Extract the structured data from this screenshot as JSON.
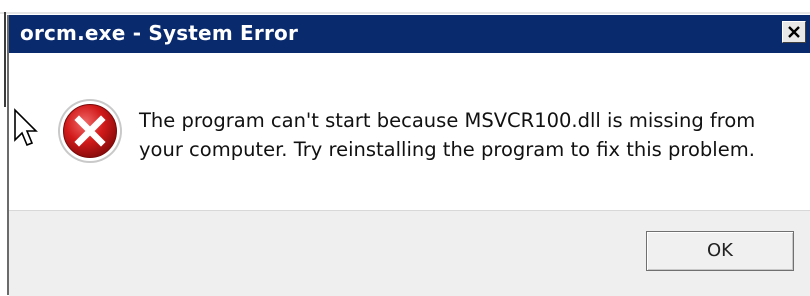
{
  "window": {
    "title": "orcm.exe - System Error"
  },
  "titlebar": {
    "close_icon": "close-icon",
    "background_color": "#0a2a6e"
  },
  "message": {
    "icon": "error-icon",
    "line1": "The program can't start because MSVCR100.dll is missing from",
    "line2": "your computer. Try reinstalling the program to fix this problem."
  },
  "buttons": {
    "ok_label": "OK"
  },
  "pointer": {
    "icon": "mouse-cursor-icon"
  }
}
